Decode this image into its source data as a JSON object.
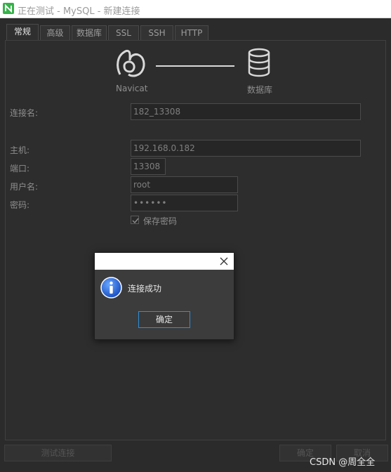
{
  "window": {
    "title": "正在测试 - MySQL - 新建连接",
    "accent": "#36b24a"
  },
  "tabs": [
    {
      "label": "常规",
      "active": true
    },
    {
      "label": "高级"
    },
    {
      "label": "数据库"
    },
    {
      "label": "SSL"
    },
    {
      "label": "SSH"
    },
    {
      "label": "HTTP"
    }
  ],
  "hero": {
    "navicat_label": "Navicat",
    "database_label": "数据库",
    "left_icon": "navicat-logo-icon",
    "right_icon": "database-icon"
  },
  "form": {
    "connection_name": {
      "label": "连接名:",
      "value": "182_13308"
    },
    "host": {
      "label": "主机:",
      "value": "192.168.0.182"
    },
    "port": {
      "label": "端口:",
      "value": "13308"
    },
    "username": {
      "label": "用户名:",
      "value": "root"
    },
    "password": {
      "label": "密码:",
      "value": "••••••"
    },
    "save_password": {
      "label": "保存密码",
      "checked": true
    }
  },
  "footer": {
    "test_button": "测试连接",
    "ok_button": "确定",
    "cancel_button": "取消"
  },
  "dialog": {
    "message": "连接成功",
    "ok_button": "确定",
    "icon": "info-icon",
    "close_icon": "close-icon"
  },
  "watermark": "CSDN @周全全"
}
